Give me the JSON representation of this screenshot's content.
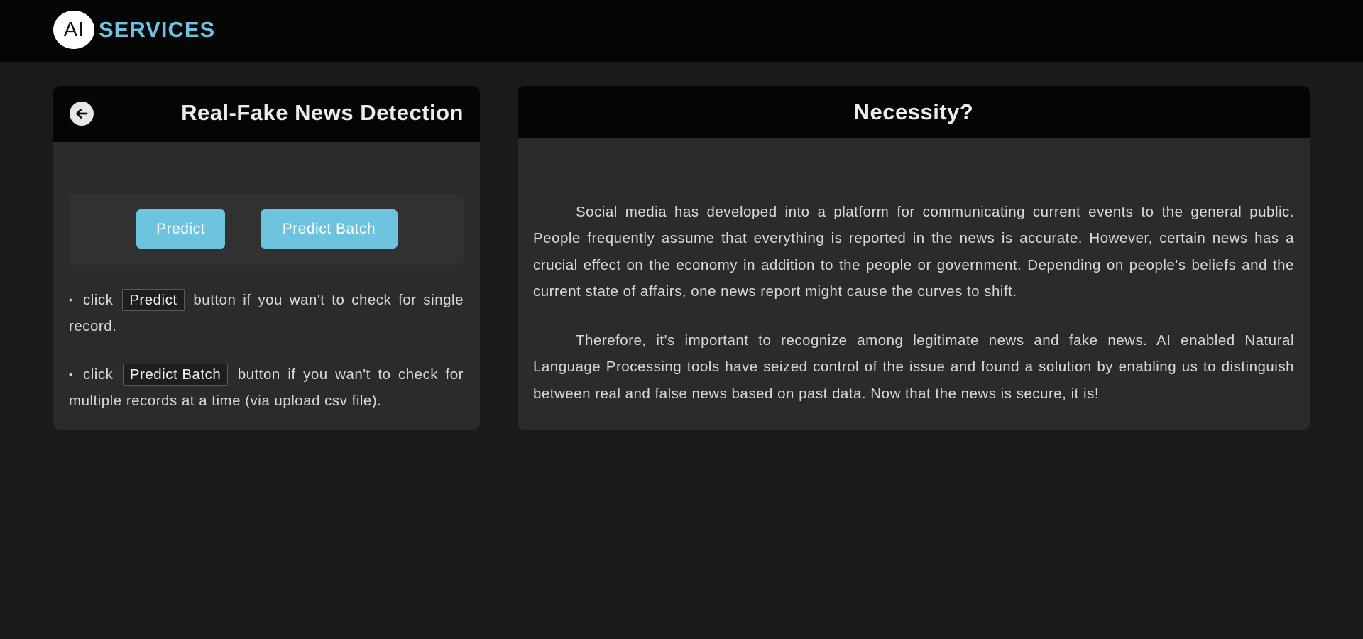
{
  "brand": {
    "logo_text": "AI",
    "name": "SERVICES"
  },
  "left_card": {
    "title": "Real-Fake News Detection",
    "back_icon": "arrow-left-circle-icon",
    "buttons": {
      "predict": "Predict",
      "predict_batch": "Predict Batch"
    },
    "instructions": [
      {
        "prefix": "click",
        "key": "Predict",
        "suffix": "button if you wan't to check for single record."
      },
      {
        "prefix": "click",
        "key": "Predict Batch",
        "suffix": "button if you wan't to check for multiple records at a time (via upload csv file)."
      }
    ]
  },
  "right_card": {
    "title": "Necessity?",
    "paragraphs": [
      "Social media has developed into a platform for communicating current events to the general public. People frequently assume that everything is reported in the news is accurate. However, certain news has a crucial effect on the economy in addition to the people or government. Depending on people's beliefs and the current state of affairs, one news report might cause the curves to shift.",
      "Therefore, it's important to recognize among legitimate news and fake news. AI enabled Natural Language Processing tools have seized control of the issue and found a solution by enabling us to distinguish between real and false news based on past data. Now that the news is secure, it is!"
    ]
  },
  "colors": {
    "accent": "#6ec3de",
    "navbar_bg": "#050505",
    "page_bg": "#1b1b1b",
    "card_bg": "#2b2b2b"
  }
}
